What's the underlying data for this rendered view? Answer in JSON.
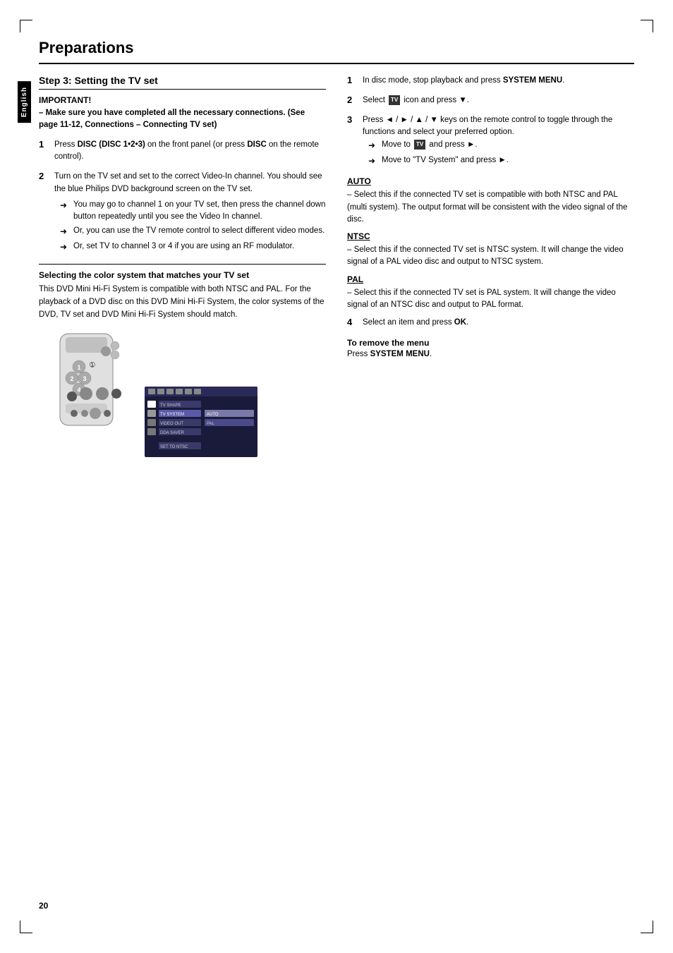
{
  "page": {
    "title": "Preparations",
    "page_number": "20",
    "language_tab": "English"
  },
  "left_column": {
    "step_heading": "Step 3:  Setting the TV set",
    "important_label": "IMPORTANT!",
    "important_text": "–  Make sure you have completed all the necessary connections. (See page 11-12, Connections – Connecting TV set)",
    "steps": [
      {
        "num": "1",
        "text": "Press DISC (DISC 1•2•3) on the front panel (or press DISC on the remote control)."
      },
      {
        "num": "2",
        "text": "Turn on the TV set and set to the correct Video-In channel. You should see the blue Philips DVD background screen on the TV set.",
        "arrows": [
          "You may go to channel 1 on your TV set, then press the channel down button repeatedly until you see the Video In channel.",
          "Or, you can use the TV remote control to select different video modes.",
          "Or, set TV to channel 3 or 4 if you are using an RF modulator."
        ]
      }
    ],
    "sub_section_heading": "Selecting the color system that matches your TV set",
    "sub_section_text": "This DVD Mini Hi-Fi System is compatible with both NTSC and PAL. For the playback of a DVD disc on this DVD Mini Hi-Fi System, the color systems of the DVD, TV set and DVD Mini Hi-Fi System should match."
  },
  "right_column": {
    "steps": [
      {
        "num": "1",
        "text": "In disc mode, stop playback and press SYSTEM MENU."
      },
      {
        "num": "2",
        "text": "Select  icon and press ▼."
      },
      {
        "num": "3",
        "text": "Press ◄ / ► / ▲ / ▼ keys on the remote control to toggle through the functions and select your preferred option.",
        "arrows": [
          "Move to  and press ►.",
          "Move to \"TV System\" and press ►."
        ]
      }
    ],
    "modes": [
      {
        "name": "AUTO",
        "text": "–  Select this if the connected TV set is compatible with both NTSC and PAL (multi system). The output format will be consistent with the video signal of the disc."
      },
      {
        "name": "NTSC",
        "text": "–  Select this if the connected TV set is NTSC system. It will change the video signal of a PAL video disc and output to NTSC system."
      },
      {
        "name": "PAL",
        "text": "–  Select this if the connected TV set is PAL system. It will change the video signal of an NTSC disc and output to PAL format."
      }
    ],
    "step_4": {
      "num": "4",
      "text": "Select an item and press OK."
    },
    "remove_menu": {
      "heading": "To remove the menu",
      "text": "Press SYSTEM MENU."
    }
  }
}
